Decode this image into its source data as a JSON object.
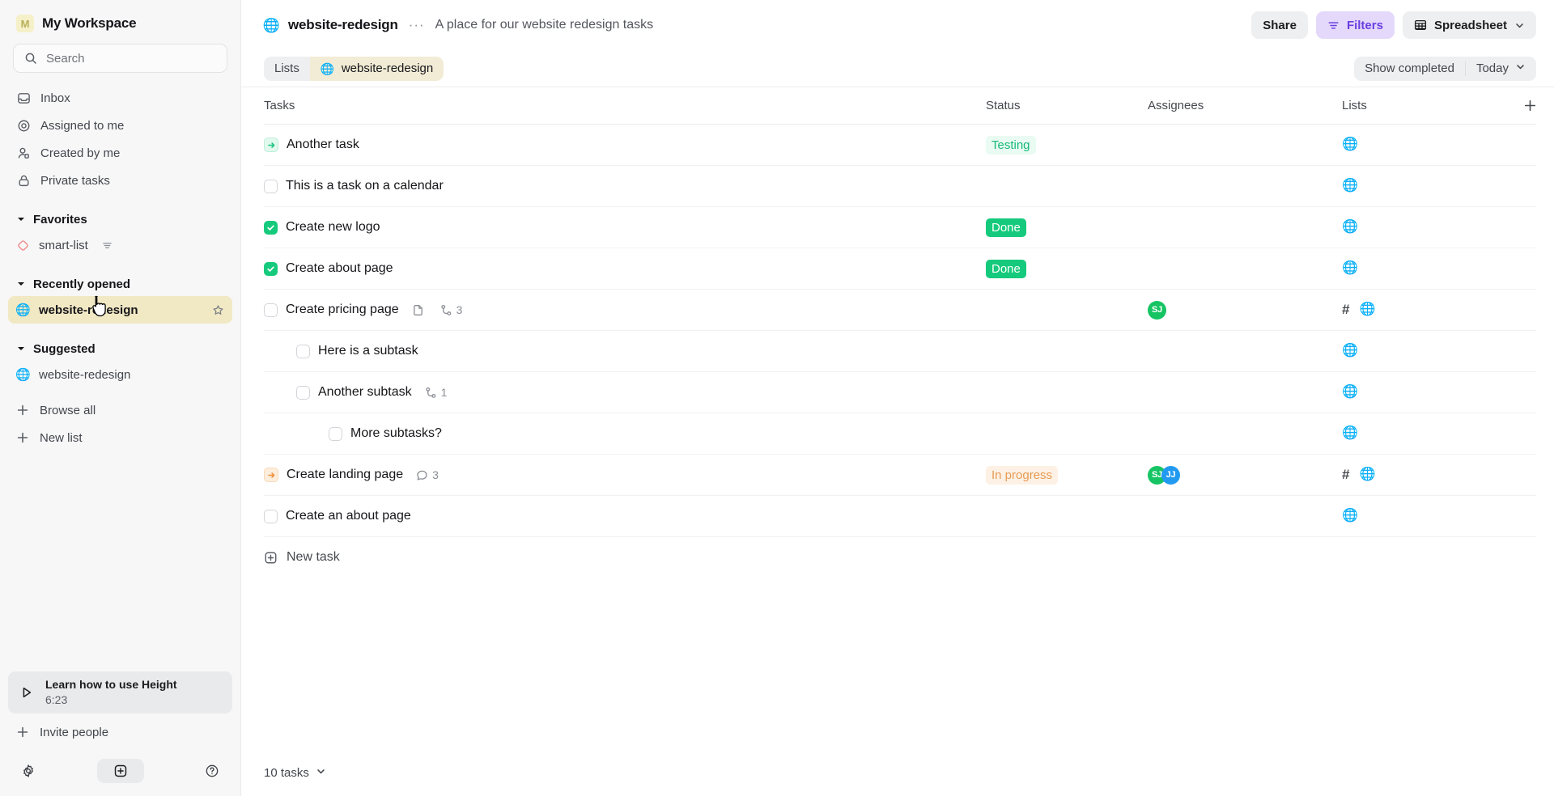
{
  "sidebar": {
    "workspace": {
      "initial": "M",
      "name": "My Workspace"
    },
    "search": {
      "placeholder": "Search",
      "value": "",
      "icon": "search-icon"
    },
    "nav": [
      {
        "label": "Inbox",
        "icon": "inbox-icon"
      },
      {
        "label": "Assigned to me",
        "icon": "target-icon"
      },
      {
        "label": "Created by me",
        "icon": "person-icon"
      },
      {
        "label": "Private tasks",
        "icon": "lock-icon"
      }
    ],
    "favorites": {
      "title": "Favorites",
      "items": [
        {
          "label": "smart-list",
          "icon": "diamond-icon",
          "trailing_icon": "filter-icon"
        }
      ]
    },
    "recently_opened": {
      "title": "Recently opened",
      "items": [
        {
          "label": "website-redesign",
          "icon": "globe-emoji",
          "active": true,
          "trailing_icon": "star-icon"
        }
      ]
    },
    "suggested": {
      "title": "Suggested",
      "items": [
        {
          "label": "website-redesign",
          "icon": "globe-emoji"
        }
      ]
    },
    "actions": [
      {
        "label": "Browse all",
        "icon": "plus-icon"
      },
      {
        "label": "New list",
        "icon": "plus-icon"
      }
    ],
    "learn_card": {
      "title": "Learn how to use Height",
      "duration": "6:23",
      "icon": "play-icon"
    },
    "invite": {
      "label": "Invite people",
      "icon": "plus-icon"
    },
    "footer": {
      "settings_icon": "gear-icon",
      "add_icon": "plus-square-icon",
      "help_icon": "question-circle-icon"
    }
  },
  "topbar": {
    "list_icon": "globe-emoji",
    "name": "website-redesign",
    "more": "···",
    "description": "A place for our website redesign tasks",
    "share_label": "Share",
    "filters_label": "Filters",
    "view_label": "Spreadsheet"
  },
  "subbar": {
    "crumb_lists": "Lists",
    "crumb_current": "website-redesign",
    "show_completed": "Show completed",
    "today": "Today"
  },
  "table": {
    "headers": {
      "tasks": "Tasks",
      "status": "Status",
      "assignees": "Assignees",
      "lists": "Lists",
      "add": "+"
    },
    "rows": [
      {
        "title": "Another task",
        "indent": 0,
        "marker": "arrow-green",
        "status": {
          "label": "Testing",
          "style": "testing"
        },
        "assignees": [],
        "lists": [
          "globe"
        ],
        "meta": []
      },
      {
        "title": "This is a task on a calendar",
        "indent": 0,
        "marker": "checkbox",
        "status": null,
        "assignees": [],
        "lists": [
          "globe"
        ],
        "meta": []
      },
      {
        "title": "Create new logo",
        "indent": 0,
        "marker": "checkbox-done",
        "status": {
          "label": "Done",
          "style": "done"
        },
        "assignees": [],
        "lists": [
          "globe"
        ],
        "meta": []
      },
      {
        "title": "Create about page",
        "indent": 0,
        "marker": "checkbox-done",
        "status": {
          "label": "Done",
          "style": "done"
        },
        "assignees": [],
        "lists": [
          "globe"
        ],
        "meta": []
      },
      {
        "title": "Create pricing page",
        "indent": 0,
        "marker": "checkbox",
        "status": null,
        "assignees": [
          {
            "initials": "SJ",
            "color": "#16c464"
          }
        ],
        "lists": [
          "hash",
          "globe"
        ],
        "meta": [
          {
            "icon": "document-icon",
            "count": ""
          },
          {
            "icon": "subtask-icon",
            "count": "3"
          }
        ]
      },
      {
        "title": "Here is a subtask",
        "indent": 1,
        "marker": "checkbox",
        "status": null,
        "assignees": [],
        "lists": [
          "globe"
        ],
        "meta": []
      },
      {
        "title": "Another subtask",
        "indent": 1,
        "marker": "checkbox",
        "status": null,
        "assignees": [],
        "lists": [
          "globe"
        ],
        "meta": [
          {
            "icon": "subtask-icon",
            "count": "1"
          }
        ]
      },
      {
        "title": "More subtasks?",
        "indent": 2,
        "marker": "checkbox",
        "status": null,
        "assignees": [],
        "lists": [
          "globe"
        ],
        "meta": []
      },
      {
        "title": "Create landing page",
        "indent": 0,
        "marker": "arrow-orange",
        "status": {
          "label": "In progress",
          "style": "inprogress"
        },
        "assignees": [
          {
            "initials": "SJ",
            "color": "#16c464"
          },
          {
            "initials": "JJ",
            "color": "#219af0"
          }
        ],
        "lists": [
          "hash",
          "globe"
        ],
        "meta": [
          {
            "icon": "comment-icon",
            "count": "3"
          }
        ]
      },
      {
        "title": "Create an about page",
        "indent": 0,
        "marker": "checkbox",
        "status": null,
        "assignees": [],
        "lists": [
          "globe"
        ],
        "meta": []
      }
    ],
    "new_task_label": "New task",
    "footer_count": "10 tasks"
  },
  "colors": {
    "accent_purple": "#6b3ee0",
    "status_done": "#15ca7c",
    "status_testing": "#16b97a",
    "status_inprogress": "#e89b54",
    "active_list": "#f1e8c4"
  }
}
